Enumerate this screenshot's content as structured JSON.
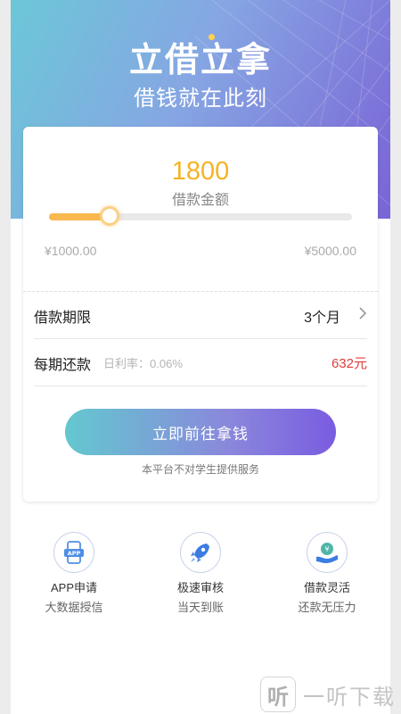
{
  "hero": {
    "title": "立借立拿",
    "subtitle": "借钱就在此刻"
  },
  "loan": {
    "amount": "1800",
    "amount_label": "借款金额",
    "min_label": "¥1000.00",
    "max_label": "¥5000.00",
    "min_value": 1000,
    "max_value": 5000,
    "current_value": 1800
  },
  "term": {
    "label": "借款期限",
    "value": "3个月"
  },
  "repayment": {
    "label": "每期还款",
    "rate": "日利率：0.06%",
    "value": "632元"
  },
  "cta": {
    "label": "立即前往拿钱",
    "notice": "本平台不对学生提供服务"
  },
  "features": [
    {
      "icon": "phone-app-icon",
      "title": "APP申请",
      "subtitle": "大数据授信"
    },
    {
      "icon": "rocket-icon",
      "title": "极速审核",
      "subtitle": "当天到账"
    },
    {
      "icon": "hand-yen-icon",
      "title": "借款灵活",
      "subtitle": "还款无压力"
    }
  ],
  "watermark": {
    "logo": "听",
    "text": "一听下载"
  },
  "colors": {
    "accent": "#f5b324",
    "danger": "#e03c3c",
    "gradient_start": "#63c8cf",
    "gradient_end": "#7a5ce0"
  }
}
